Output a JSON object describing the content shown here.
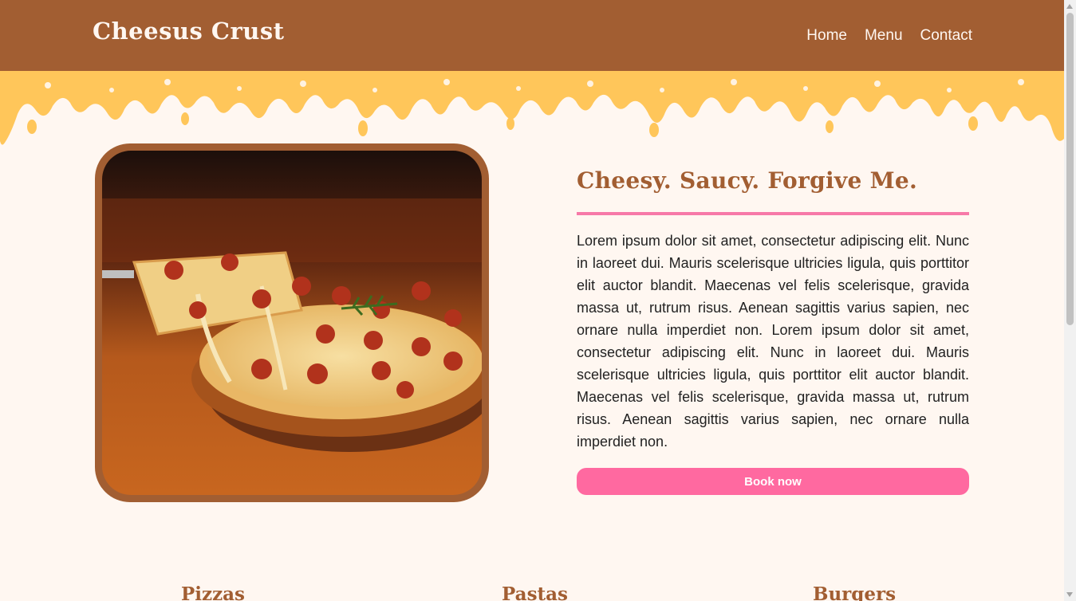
{
  "header": {
    "logo": "Cheesus Crust",
    "nav": [
      {
        "label": "Home"
      },
      {
        "label": "Menu"
      },
      {
        "label": "Contact"
      }
    ]
  },
  "hero": {
    "title": "Cheesy. Saucy. Forgive Me.",
    "text": "Lorem ipsum dolor sit amet, consectetur adipiscing elit. Nunc in laoreet dui. Mauris scelerisque ultricies ligula, quis porttitor elit auctor blandit. Maecenas vel felis scelerisque, gravida massa ut, rutrum risus. Aenean sagittis varius sapien, nec ornare nulla imperdiet non. Lorem ipsum dolor sit amet, consectetur adipiscing elit. Nunc in laoreet dui. Mauris scelerisque ultricies ligula, quis porttitor elit auctor blandit. Maecenas vel felis scelerisque, gravida massa ut, rutrum risus. Aenean sagittis varius sapien, nec ornare nulla imperdiet non.",
    "button": "Book now"
  },
  "categories": [
    {
      "label": "Pizzas"
    },
    {
      "label": "Pastas"
    },
    {
      "label": "Burgers"
    }
  ],
  "colors": {
    "brand_brown": "#a25e32",
    "cheese": "#ffc65a",
    "accent_pink": "#ff69a0",
    "background": "#fff7f1"
  }
}
